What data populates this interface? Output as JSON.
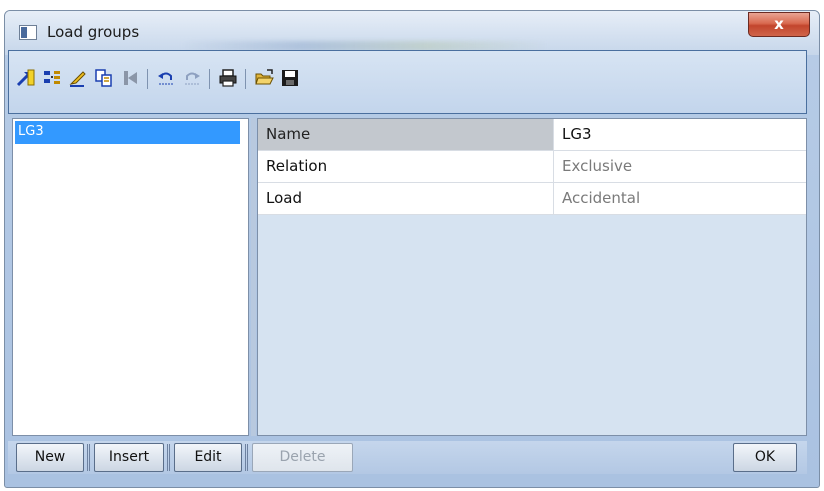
{
  "window": {
    "title": "Load groups",
    "close_label": "x"
  },
  "toolbar": {
    "icons": [
      "new-item-icon",
      "columns-icon",
      "edit-pencil-icon",
      "copy-icon",
      "filter-icon",
      "undo-icon",
      "redo-icon",
      "print-icon",
      "open-folder-icon",
      "save-disk-icon"
    ]
  },
  "list": {
    "items": [
      {
        "label": "LG3",
        "selected": true
      }
    ]
  },
  "properties": {
    "rows": [
      {
        "name": "Name",
        "value": "LG3"
      },
      {
        "name": "Relation",
        "value": "Exclusive"
      },
      {
        "name": "Load",
        "value": "Accidental"
      }
    ]
  },
  "buttons": {
    "new": "New",
    "insert": "Insert",
    "edit": "Edit",
    "delete": "Delete",
    "ok": "OK"
  },
  "colors": {
    "selection": "#3399ff",
    "panel_bg": "#d6e3f1",
    "frame": "#aac2e1"
  }
}
